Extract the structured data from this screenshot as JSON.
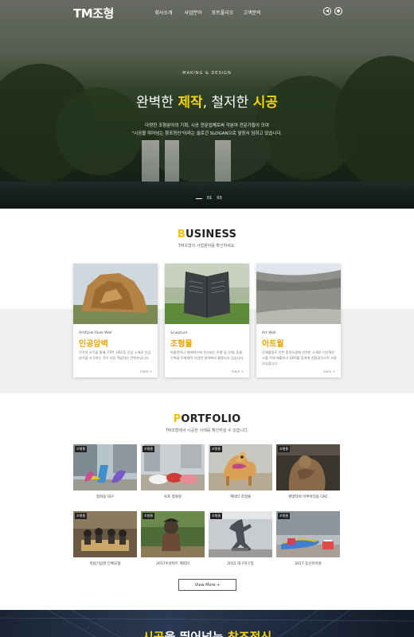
{
  "nav": {
    "logo": "TM조형",
    "menu": [
      "회사소개",
      "사업분야",
      "포트폴리오",
      "고객문의"
    ],
    "icons": [
      "sound-icon",
      "location-icon"
    ]
  },
  "hero": {
    "kicker": "MAKING & DESIGN",
    "title_part1": "완벽한 ",
    "title_hl1": "제작",
    "title_part2": ", 철저한 ",
    "title_hl2": "시공",
    "desc_line1": "다양한 조형분야의 기획, 시공 전문업체로써 각분야 전문가들이 모여",
    "desc_line2": "\"시공을 뛰어넘는 창조정신\"이라는 슬로건 SLOGAN으로 앞장서 임하고 있습니다.",
    "pager_current": "01",
    "pager_total": "03"
  },
  "business": {
    "title_first": "B",
    "title_rest": "USINESS",
    "subtitle": "TM조형의 사업분야를 확인하세요.",
    "cards": [
      {
        "en": "Artificial Rock Wall",
        "ko": "인공암벽",
        "desc": "각각의 조각을 통해, FRP, GRC등 신업 소재로 인공 암석을 조각하는 것이 가장 핵심적인 전변조입니다.",
        "more": "more +"
      },
      {
        "en": "Sculpture",
        "ko": "조형물",
        "desc": "박물관이나 테마파크에 전시되는 모형 및 인체, 동물, 건축물 모형제작 다양한 분야에서 활용되고 있습니다.",
        "more": "more +"
      },
      {
        "en": "Art Wall",
        "ko": "아트월",
        "desc": "무채몰질로 인한 환경오염에 안전한 소재로 이산화탄소를 적게 배출하고 GRS를 합쳐에 친환경적으로 사용가능합니다.",
        "more": "more +"
      }
    ]
  },
  "portfolio": {
    "title_first": "P",
    "title_rest": "ORTFOLIO",
    "subtitle": "TM조형에서 시공한 사례를 확인하실 수 있습니다.",
    "items": [
      {
        "tag": "조형물",
        "caption": "청와용 대구"
      },
      {
        "tag": "조형물",
        "caption": "육포 청와랑"
      },
      {
        "tag": "조형물",
        "caption": "캐릭터 조형물"
      },
      {
        "tag": "조형물",
        "caption": "롯데타워 아쿠아리움 GRC"
      },
      {
        "tag": "조형물",
        "caption": "독립기념관 인체모형"
      },
      {
        "tag": "조형물",
        "caption": "2017수성아트 캐릭터"
      },
      {
        "tag": "조형물",
        "caption": "2015 대구마구장"
      },
      {
        "tag": "조형물",
        "caption": "2017 동산유아원"
      }
    ],
    "view_more": "View More +"
  },
  "banner": {
    "text_hl": "시공",
    "text_rest": "을 뛰어넘는 ",
    "text_hl2": "창조정신"
  }
}
